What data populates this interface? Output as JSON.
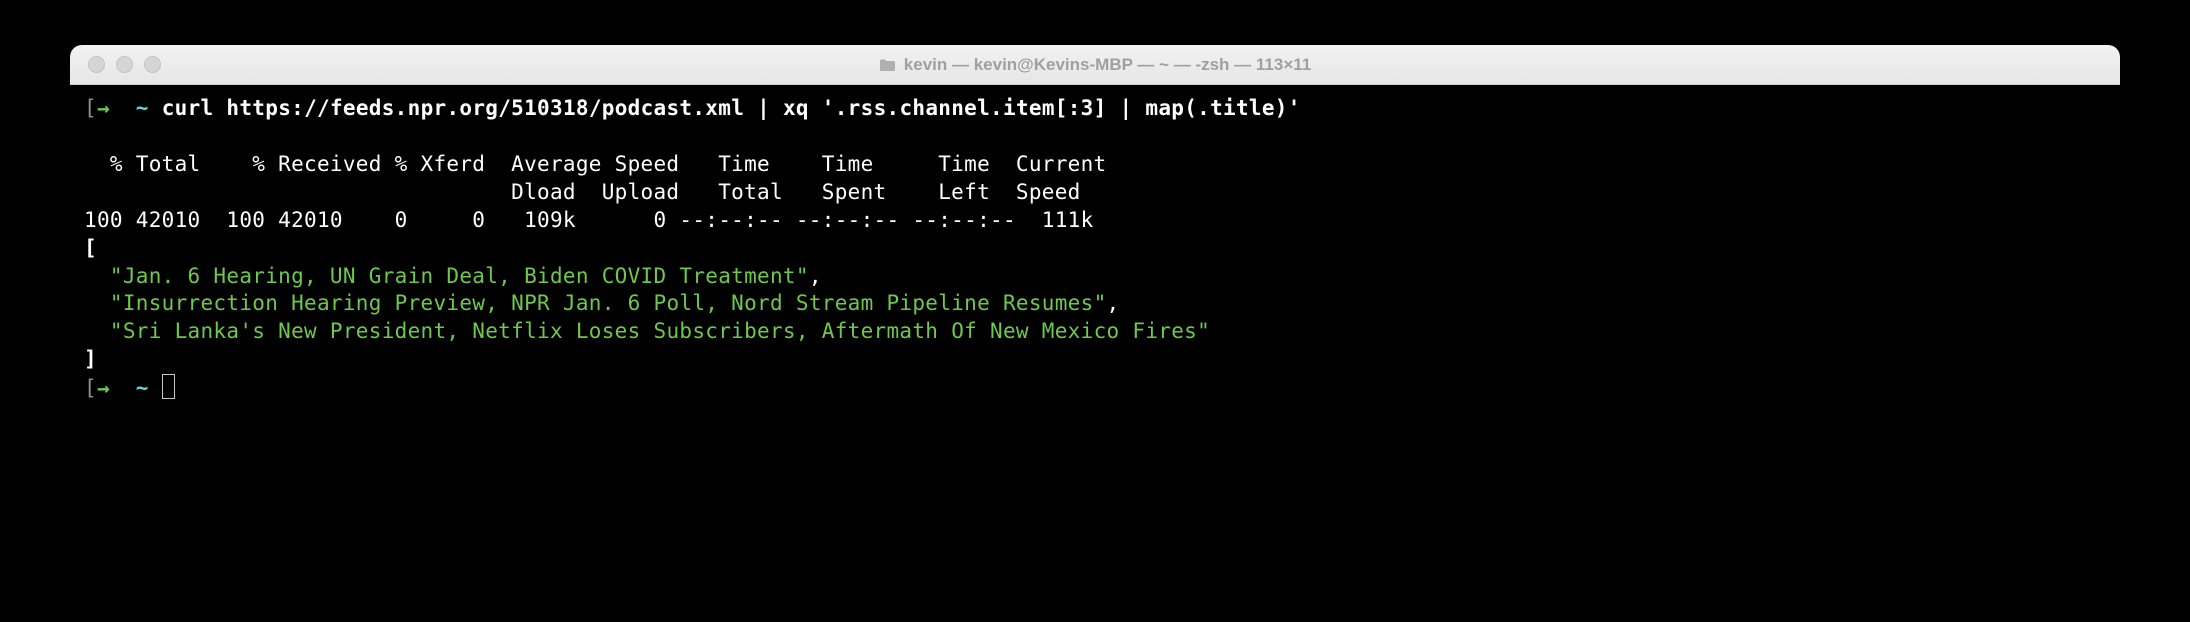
{
  "window": {
    "title": "kevin — kevin@Kevins-MBP — ~ — -zsh — 113×11"
  },
  "prompt": {
    "bracket_open": "[",
    "arrow": "→",
    "tilde": "~",
    "bracket_close": "]"
  },
  "command": "curl https://feeds.npr.org/510318/podcast.xml | xq '.rss.channel.item[:3] | map(.title)'",
  "transfer_header1": "  % Total    % Received % Xferd  Average Speed   Time    Time     Time  Current",
  "transfer_header2": "                                 Dload  Upload   Total   Spent    Left  Speed",
  "transfer_data": "100 42010  100 42010    0     0   109k      0 --:--:-- --:--:-- --:--:--  111k",
  "json_open": "[",
  "json_items": [
    "\"Jan. 6 Hearing, UN Grain Deal, Biden COVID Treatment\"",
    "\"Insurrection Hearing Preview, NPR Jan. 6 Poll, Nord Stream Pipeline Resumes\"",
    "\"Sri Lanka's New President, Netflix Loses Subscribers, Aftermath Of New Mexico Fires\""
  ],
  "json_comma": ",",
  "json_close": "]"
}
